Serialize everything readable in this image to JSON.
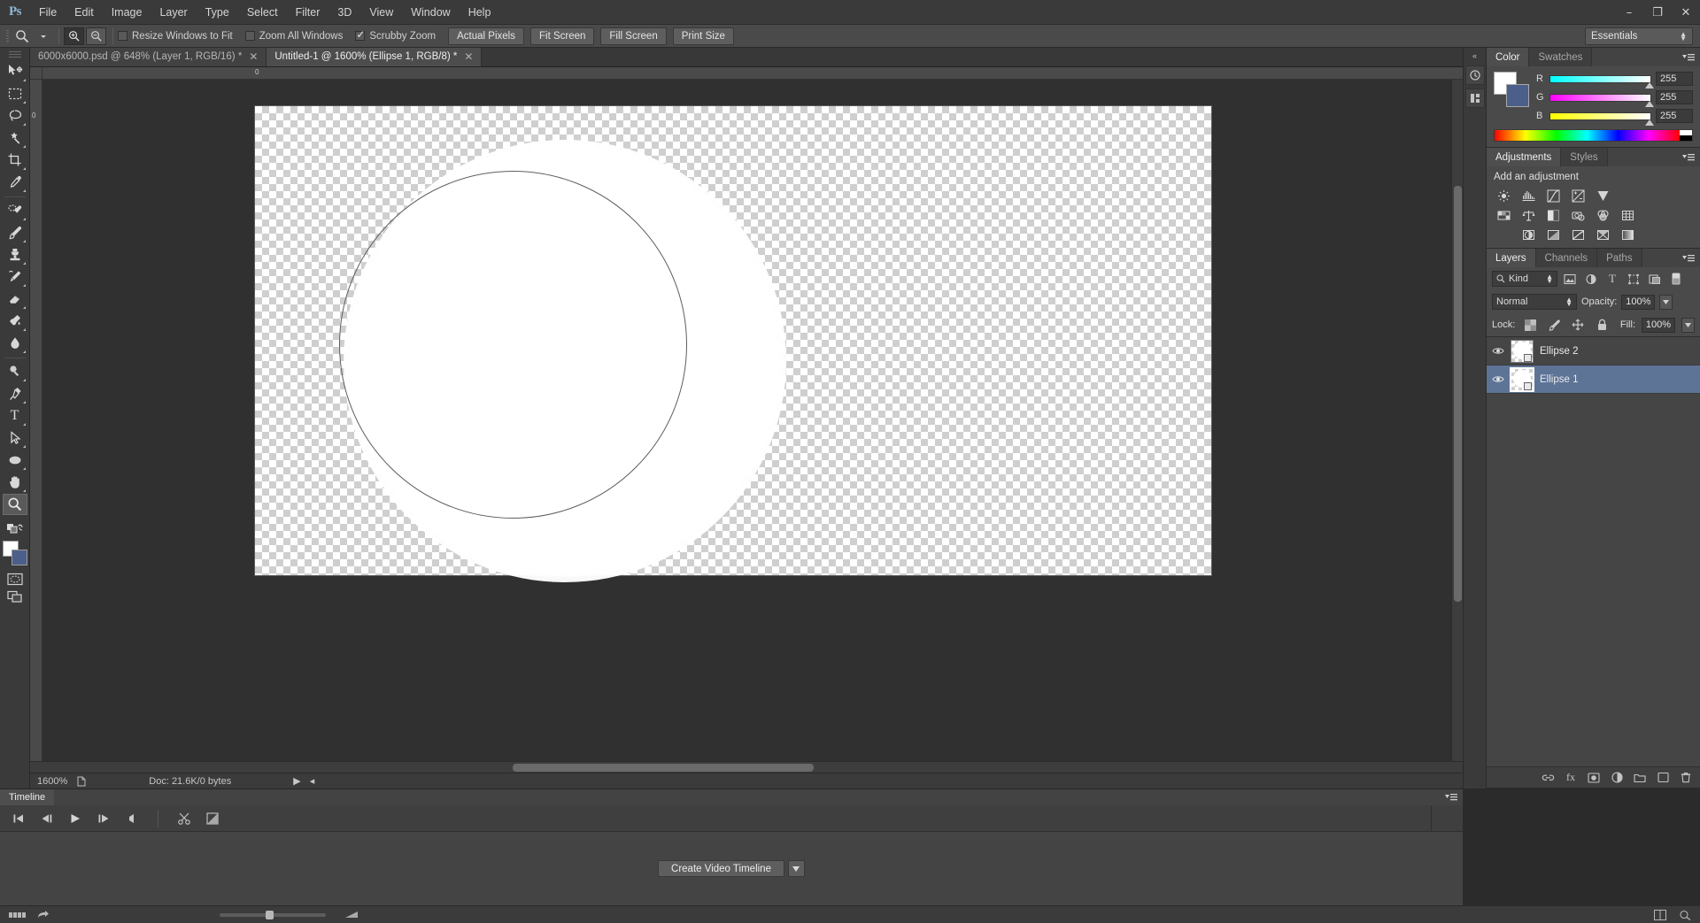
{
  "app": {
    "name": "Ps",
    "logo_color": "#8fb7d6"
  },
  "menubar": {
    "items": [
      "File",
      "Edit",
      "Image",
      "Layer",
      "Type",
      "Select",
      "Filter",
      "3D",
      "View",
      "Window",
      "Help"
    ]
  },
  "window_controls": {
    "minimize": "–",
    "maximize": "❐",
    "close": "✕"
  },
  "options_bar": {
    "tool_icon": "zoom-tool-icon",
    "zoom_in_label": "zoom-in",
    "zoom_out_label": "zoom-out",
    "checkboxes": [
      {
        "label": "Resize Windows to Fit",
        "checked": false
      },
      {
        "label": "Zoom All Windows",
        "checked": false
      },
      {
        "label": "Scrubby Zoom",
        "checked": true
      }
    ],
    "buttons": [
      "Actual Pixels",
      "Fit Screen",
      "Fill Screen",
      "Print Size"
    ],
    "workspace": "Essentials"
  },
  "document_tabs": [
    {
      "label": "6000x6000.psd @ 648% (Layer 1, RGB/16) *",
      "active": false,
      "close": "✕"
    },
    {
      "label": "Untitled-1 @ 1600% (Ellipse 1, RGB/8) *",
      "active": true,
      "close": "✕"
    }
  ],
  "rulers": {
    "horizontal_tick": "0",
    "vertical_tick": "0"
  },
  "status_bar": {
    "zoom": "1600%",
    "doc_info": "Doc: 21.6K/0 bytes",
    "play_arrow": "▶",
    "left_arrow": "◂"
  },
  "toolbar": {
    "tools": [
      {
        "name": "move-tool",
        "active": false
      },
      {
        "name": "rectangular-marquee-tool",
        "active": false
      },
      {
        "name": "lasso-tool",
        "active": false
      },
      {
        "name": "magic-wand-tool",
        "active": false
      },
      {
        "name": "crop-tool",
        "active": false
      },
      {
        "name": "eyedropper-tool",
        "active": false
      },
      {
        "name": "spot-healing-brush-tool",
        "active": false
      },
      {
        "name": "brush-tool",
        "active": false
      },
      {
        "name": "clone-stamp-tool",
        "active": false
      },
      {
        "name": "history-brush-tool",
        "active": false
      },
      {
        "name": "eraser-tool",
        "active": false
      },
      {
        "name": "gradient-tool",
        "active": false
      },
      {
        "name": "blur-tool",
        "active": false
      },
      {
        "name": "dodge-tool",
        "active": false
      },
      {
        "name": "pen-tool",
        "active": false
      },
      {
        "name": "horizontal-type-tool",
        "label": "T",
        "active": false
      },
      {
        "name": "path-selection-tool",
        "active": false
      },
      {
        "name": "ellipse-tool",
        "active": false
      },
      {
        "name": "hand-tool",
        "active": false
      },
      {
        "name": "zoom-tool",
        "active": true
      }
    ],
    "foreground_color": "#ffffff",
    "background_color": "#4c5f8a",
    "quick_mask": "quick-mask-mode",
    "screen_mode": "screen-mode"
  },
  "color_panel": {
    "tabs": [
      {
        "label": "Color",
        "active": true
      },
      {
        "label": "Swatches",
        "active": false
      }
    ],
    "foreground": "#ffffff",
    "background": "#4c5f8a",
    "channels": [
      {
        "label": "R",
        "value": "255"
      },
      {
        "label": "G",
        "value": "255"
      },
      {
        "label": "B",
        "value": "255"
      }
    ]
  },
  "adjustments_panel": {
    "tabs": [
      {
        "label": "Adjustments",
        "active": true
      },
      {
        "label": "Styles",
        "active": false
      }
    ],
    "heading": "Add an adjustment",
    "rows": [
      [
        "brightness-contrast-icon",
        "levels-icon",
        "curves-icon",
        "exposure-icon",
        "vibrance-icon"
      ],
      [
        "hue-saturation-icon",
        "color-balance-icon",
        "black-white-icon",
        "photo-filter-icon",
        "channel-mixer-icon",
        "color-lookup-icon"
      ],
      [
        "invert-icon",
        "posterize-icon",
        "threshold-icon",
        "selective-color-icon",
        "gradient-map-icon"
      ]
    ]
  },
  "layers_panel": {
    "tabs": [
      {
        "label": "Layers",
        "active": true
      },
      {
        "label": "Channels",
        "active": false
      },
      {
        "label": "Paths",
        "active": false
      }
    ],
    "filter": {
      "kind_label": "Kind",
      "icons": [
        "filter-pixel-icon",
        "filter-adjustment-icon",
        "filter-type-icon",
        "filter-shape-icon",
        "filter-smart-object-icon",
        "filter-toggle-icon"
      ]
    },
    "blend_mode": "Normal",
    "opacity_label": "Opacity:",
    "opacity_value": "100%",
    "lock_label": "Lock:",
    "lock_icons": [
      "lock-transparent-pixels-icon",
      "lock-image-pixels-icon",
      "lock-position-icon",
      "lock-all-icon"
    ],
    "fill_label": "Fill:",
    "fill_value": "100%",
    "layers": [
      {
        "name": "Ellipse 2",
        "visible": true,
        "selected": false
      },
      {
        "name": "Ellipse 1",
        "visible": true,
        "selected": true
      }
    ],
    "footer_icons": [
      "link-layers-icon",
      "layer-style-icon",
      "add-layer-mask-icon",
      "new-fill-adjustment-icon",
      "new-group-icon",
      "new-layer-icon",
      "delete-layer-icon"
    ]
  },
  "timeline_panel": {
    "tab": "Timeline",
    "transport": [
      "go-to-first-frame-icon",
      "previous-frame-icon",
      "play-icon",
      "next-frame-icon",
      "audio-icon"
    ],
    "tools": [
      "split-at-playhead-icon",
      "transition-icon"
    ],
    "create_button": "Create Video Timeline",
    "create_dropdown": "▾"
  },
  "bottom_bar": {
    "left_icons": [
      "grid-view-icon",
      "share-icon"
    ],
    "right_icons": [
      "tile-icon",
      "zoom-level-icon"
    ]
  },
  "canvas": {
    "artboard_label": "transparent-checkerboard-canvas",
    "shape_label": "white-ellipse-glow",
    "path_label": "ellipse-vector-path"
  }
}
